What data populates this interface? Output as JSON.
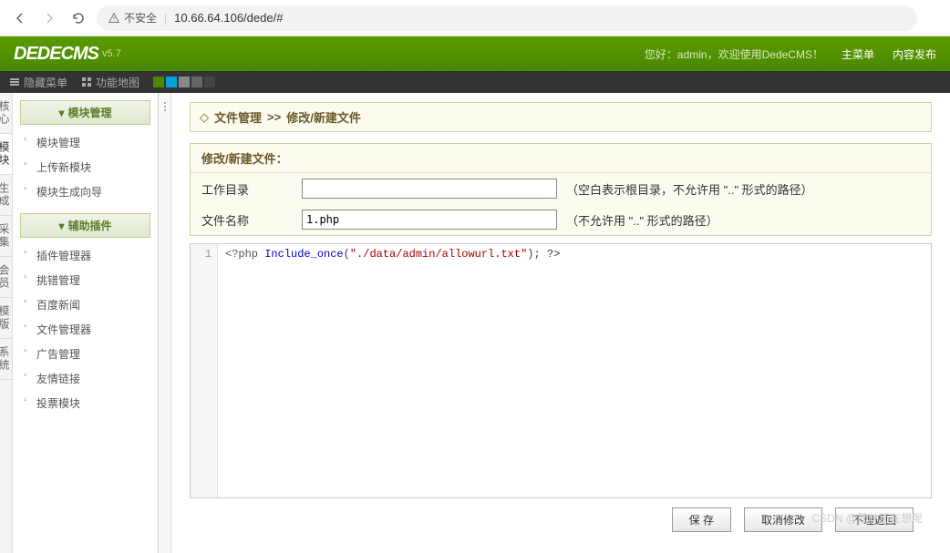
{
  "browser": {
    "insecure_label": "不安全",
    "url": "10.66.64.106/dede/#"
  },
  "header": {
    "logo": "DEDECMS",
    "version": "v5.7",
    "welcome_prefix": "您好：",
    "welcome_user": "admin",
    "welcome_suffix": "，欢迎使用DedeCMS！",
    "main_menu": "主菜单",
    "content_publish": "内容发布"
  },
  "sub_toolbar": {
    "hide_menu": "隐藏菜单",
    "function_map": "功能地图"
  },
  "vtabs": [
    "核心",
    "模块",
    "生成",
    "采集",
    "会员",
    "模版",
    "系统"
  ],
  "sidebar": {
    "section1": {
      "title": "模块管理",
      "items": [
        "模块管理",
        "上传新模块",
        "模块生成向导"
      ]
    },
    "section2": {
      "title": "辅助插件",
      "items": [
        "插件管理器",
        "挑错管理",
        "百度新闻",
        "文件管理器",
        "广告管理",
        "友情链接",
        "投票模块"
      ]
    }
  },
  "breadcrumb": {
    "root": "文件管理",
    "sep": ">>",
    "current": "修改/新建文件"
  },
  "form": {
    "title": "修改/新建文件：",
    "work_dir_label": "工作目录",
    "work_dir_value": "",
    "work_dir_hint": "（空白表示根目录，不允许用 \"..\" 形式的路径）",
    "file_name_label": "文件名称",
    "file_name_value": "1.php",
    "file_name_hint": "（不允许用 \"..\" 形式的路径）"
  },
  "code": {
    "line_no": "1",
    "t1": "<?php ",
    "t2": "Include_once",
    "t3": "(",
    "t4": "\"./data/admin/allowurl.txt\"",
    "t5": "); ?>"
  },
  "buttons": {
    "save": "保 存",
    "cancel": "取消修改",
    "back": "不理返回"
  },
  "watermark": "CSDN @魏林还在想呢"
}
